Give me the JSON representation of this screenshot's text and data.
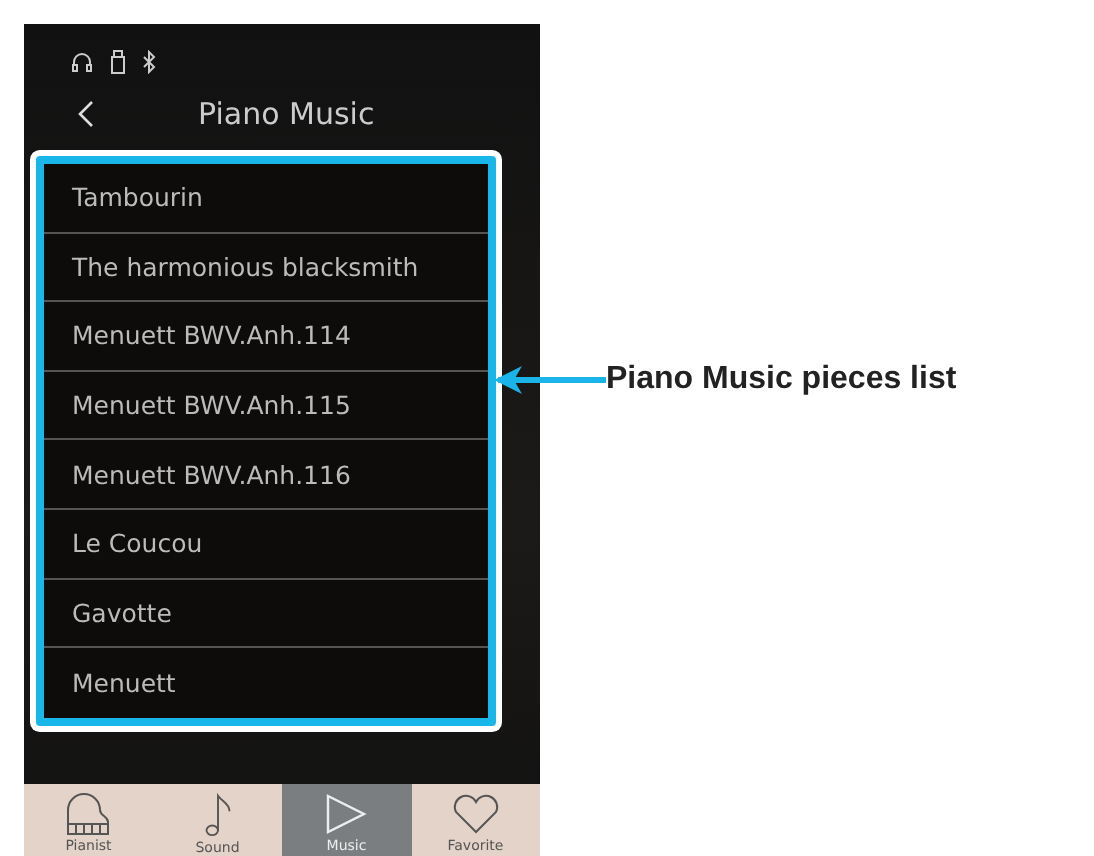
{
  "header": {
    "title": "Piano Music"
  },
  "pieces": [
    "Tambourin",
    "The harmonious blacksmith",
    "Menuett BWV.Anh.114",
    "Menuett BWV.Anh.115",
    "Menuett BWV.Anh.116",
    "Le Coucou",
    "Gavotte",
    "Menuett"
  ],
  "tabs": [
    {
      "label": "Pianist",
      "kind": "piano",
      "selected": false
    },
    {
      "label": "Sound",
      "kind": "note",
      "selected": false
    },
    {
      "label": "Music",
      "kind": "play",
      "selected": true
    },
    {
      "label": "Favorite",
      "kind": "heart",
      "selected": false
    }
  ],
  "callout": {
    "label": "Piano Music pieces list"
  }
}
